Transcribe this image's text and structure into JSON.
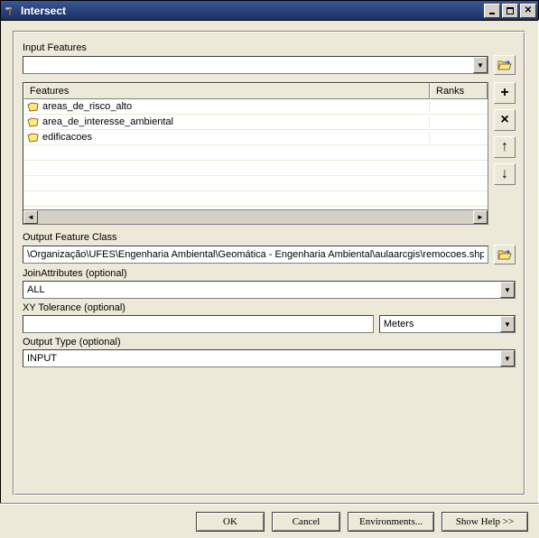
{
  "window": {
    "title": "Intersect"
  },
  "input_features": {
    "label": "Input Features",
    "value": "",
    "table": {
      "col_features": "Features",
      "col_ranks": "Ranks",
      "rows": [
        {
          "name": "areas_de_risco_alto",
          "rank": ""
        },
        {
          "name": "area_de_interesse_ambiental",
          "rank": ""
        },
        {
          "name": "edificacoes",
          "rank": ""
        }
      ]
    }
  },
  "output_feature_class": {
    "label": "Output Feature Class",
    "value": "\\Organização\\UFES\\Engenharia Ambiental\\Geomática - Engenharia Ambiental\\aulaarcgis\\remocoes.shp"
  },
  "join_attributes": {
    "label": "JoinAttributes (optional)",
    "value": "ALL"
  },
  "xy_tolerance": {
    "label": "XY Tolerance (optional)",
    "value": "",
    "units": "Meters"
  },
  "output_type": {
    "label": "Output Type (optional)",
    "value": "INPUT"
  },
  "buttons": {
    "ok": "OK",
    "cancel": "Cancel",
    "environments": "Environments...",
    "show_help": "Show Help >>"
  },
  "side": {
    "add": "+",
    "remove": "×",
    "up": "↑",
    "down": "↓"
  }
}
